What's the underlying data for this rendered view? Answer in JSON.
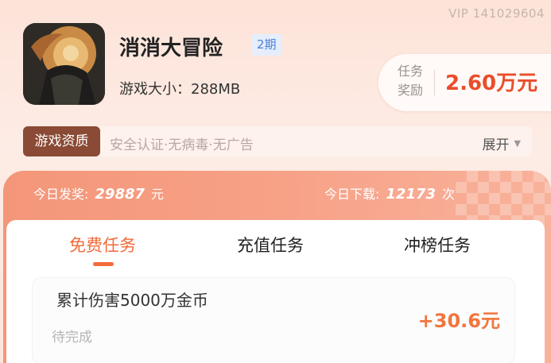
{
  "header": {
    "vip_text": "VIP 141029604"
  },
  "game": {
    "title": "消消大冒险",
    "period_badge": "2期",
    "size_text": "游戏大小：288MB"
  },
  "reward": {
    "label_line1": "任务",
    "label_line2": "奖励",
    "amount": "2.60万元"
  },
  "qualification": {
    "tag": "游戏资质",
    "text": "安全认证·无病毒·无广告",
    "expand_label": "展开",
    "expand_icon": "triangle-down-icon"
  },
  "stats": {
    "left_label": "今日发奖:",
    "left_value": "29887",
    "left_unit": "元",
    "right_label": "今日下载:",
    "right_value": "12173",
    "right_unit": "次"
  },
  "tabs": [
    {
      "label": "免费任务",
      "active": true
    },
    {
      "label": "充值任务",
      "active": false
    },
    {
      "label": "冲榜任务",
      "active": false
    }
  ],
  "tasks": [
    {
      "title": "累计伤害5000万金币",
      "status": "待完成",
      "reward": "+30.6元"
    }
  ],
  "colors": {
    "accent": "#f26a3a",
    "reward_red": "#ea4d2c",
    "badge_blue": "#4a7fd6",
    "qual_tag_bg": "#8a4a35"
  }
}
